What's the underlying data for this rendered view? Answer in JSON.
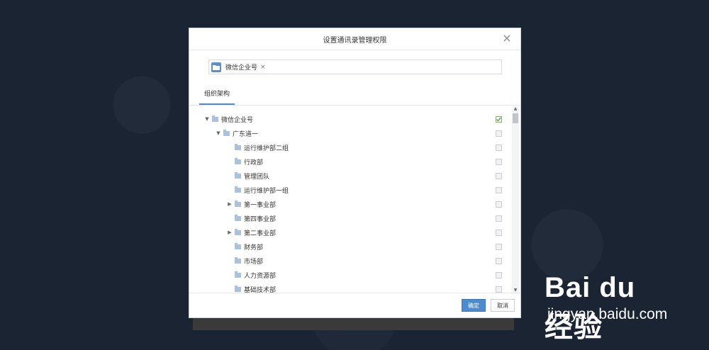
{
  "dialog": {
    "title": "设置通讯录管理权限",
    "close_icon": "×"
  },
  "selected": {
    "tag_label": "微信企业号",
    "tag_remove": "×"
  },
  "tabs": [
    {
      "label": "组织架构"
    }
  ],
  "tree": [
    {
      "label": "微信企业号",
      "level": 0,
      "expanded": true,
      "checked": true
    },
    {
      "label": "广东道一",
      "level": 1,
      "expanded": true,
      "checked": false
    },
    {
      "label": "运行维护部二组",
      "level": 2,
      "checked": false
    },
    {
      "label": "行政部",
      "level": 2,
      "checked": false
    },
    {
      "label": "管理团队",
      "level": 2,
      "checked": false
    },
    {
      "label": "运行维护部一组",
      "level": 2,
      "checked": false
    },
    {
      "label": "第一事业部",
      "level": 2,
      "collapsed": true,
      "checked": false
    },
    {
      "label": "第四事业部",
      "level": 2,
      "checked": false
    },
    {
      "label": "第二事业部",
      "level": 2,
      "collapsed": true,
      "checked": false
    },
    {
      "label": "财务部",
      "level": 2,
      "checked": false
    },
    {
      "label": "市场部",
      "level": 2,
      "checked": false
    },
    {
      "label": "人力资源部",
      "level": 2,
      "checked": false
    },
    {
      "label": "基础技术部",
      "level": 2,
      "checked": false
    }
  ],
  "footer": {
    "ok_label": "确定",
    "cancel_label": "取消"
  },
  "watermark": {
    "logo": "Bai du 经验",
    "sub": "jingyan.baidu.com"
  },
  "colors": {
    "accent": "#4c8bd0",
    "background": "#1b2433",
    "check": "#7ab46a"
  }
}
